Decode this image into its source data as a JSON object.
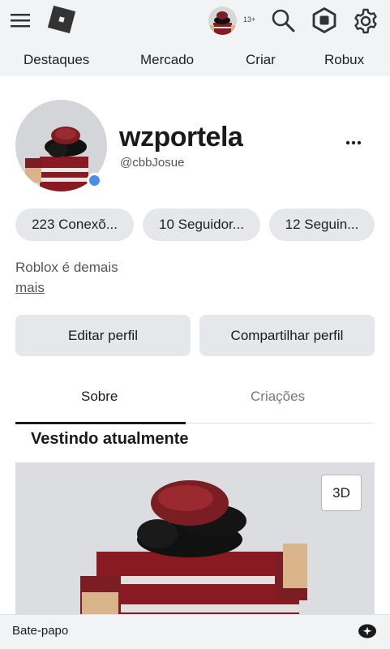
{
  "header": {
    "age_badge": "13+",
    "icons": [
      "menu-icon",
      "roblox-logo-icon",
      "avatar-thumbnail",
      "search-icon",
      "robux-icon",
      "gear-icon"
    ]
  },
  "nav": {
    "items": [
      {
        "label": "Destaques"
      },
      {
        "label": "Mercado"
      },
      {
        "label": "Criar"
      },
      {
        "label": "Robux"
      }
    ]
  },
  "profile": {
    "display_name": "wzportela",
    "username": "@cbbJosue",
    "online_status_color": "#4a8fe7",
    "stats": [
      {
        "label": "223 Conexõ..."
      },
      {
        "label": "10 Seguidor..."
      },
      {
        "label": "12 Seguin..."
      }
    ],
    "bio": "Roblox é demais",
    "more_link": "mais"
  },
  "actions": {
    "edit_label": "Editar perfil",
    "share_label": "Compartilhar perfil"
  },
  "tabs": {
    "items": [
      {
        "label": "Sobre",
        "active": true
      },
      {
        "label": "Criações",
        "active": false
      }
    ]
  },
  "wearing": {
    "title": "Vestindo atualmente",
    "view_3d_label": "3D"
  },
  "chat": {
    "label": "Bate-papo"
  },
  "colors": {
    "chrome_bg": "#f2f3f4",
    "pill_bg": "#e6e7ea",
    "avatar_shirt": "#8a1a22",
    "avatar_skin": "#d9b48a"
  }
}
